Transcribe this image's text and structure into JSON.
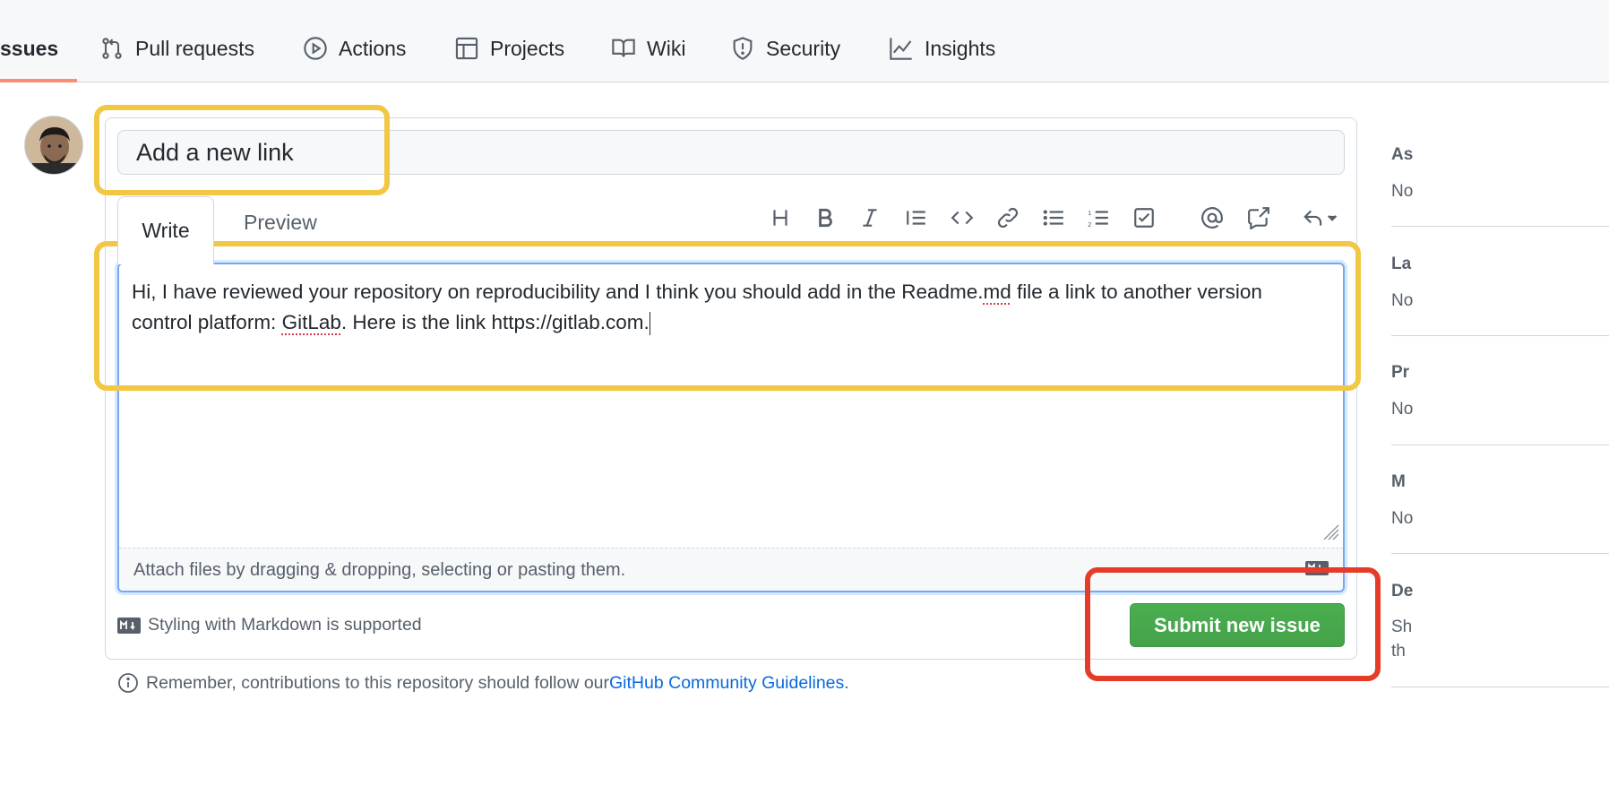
{
  "nav": {
    "tabs": [
      {
        "label": "ssues",
        "icon": "issue-icon"
      },
      {
        "label": "Pull requests",
        "icon": "git-pull-request-icon"
      },
      {
        "label": "Actions",
        "icon": "play-icon"
      },
      {
        "label": "Projects",
        "icon": "table-icon"
      },
      {
        "label": "Wiki",
        "icon": "book-icon"
      },
      {
        "label": "Security",
        "icon": "shield-icon"
      },
      {
        "label": "Insights",
        "icon": "graph-icon"
      }
    ],
    "active_tab": "ssues"
  },
  "issue": {
    "title_value": "Add a new link",
    "tabs": {
      "write": "Write",
      "preview": "Preview"
    },
    "body_part1": "Hi, I have reviewed your repository on reproducibility and I think you should add in the Readme.",
    "body_misspelled1": "md",
    "body_part2": " file a link to another version control platform: ",
    "body_misspelled2": "GitLab",
    "body_part3": ". Here is the link https://gitlab.com.",
    "attach_hint": "Attach files by dragging & dropping, selecting or pasting them.",
    "markdown_note": "Styling with Markdown is supported",
    "submit_label": "Submit new issue",
    "guideline_prefix": "Remember, contributions to this repository should follow our ",
    "guideline_link": "GitHub Community Guidelines",
    "guideline_suffix": "."
  },
  "toolbar": {
    "icons": [
      "heading-icon",
      "bold-icon",
      "italic-icon",
      "quote-icon",
      "code-icon",
      "link-icon",
      "bullet-list-icon",
      "numbered-list-icon",
      "task-list-icon",
      "mention-icon",
      "cross-reference-icon",
      "reply-icon"
    ]
  },
  "sidebar": {
    "sections": [
      {
        "head": "As",
        "value": "No"
      },
      {
        "head": "La",
        "value": "No"
      },
      {
        "head": "Pr",
        "value": "No"
      },
      {
        "head": "M",
        "value": "No"
      },
      {
        "head": "De",
        "value": "Sh",
        "value2": "th"
      }
    ]
  },
  "colors": {
    "annotation_highlight": "#f2c744",
    "annotation_submit": "#e53b28",
    "submit_button": "#2da44e",
    "link": "#0969da"
  }
}
